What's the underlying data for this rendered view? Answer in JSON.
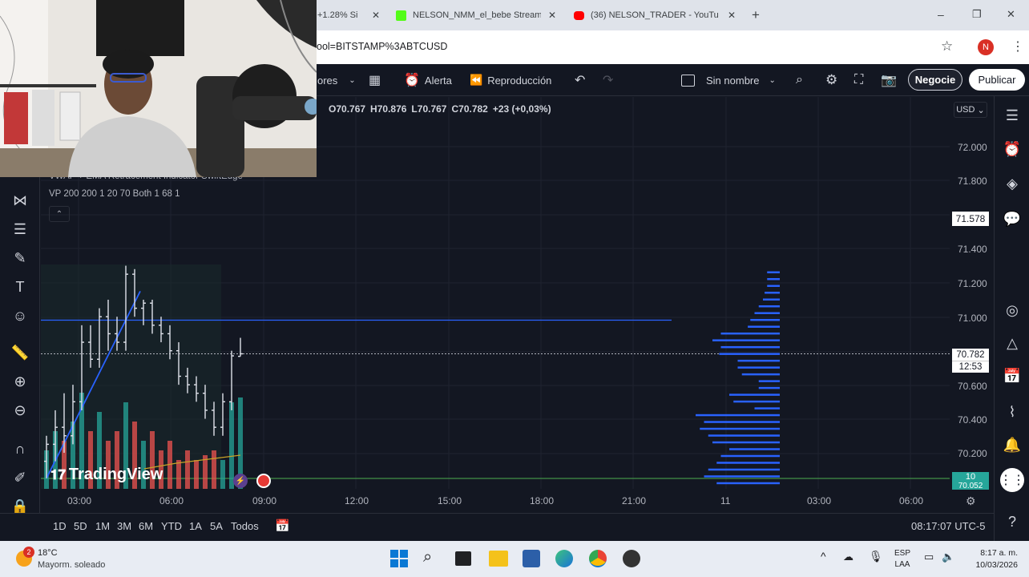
{
  "browser": {
    "tabs": [
      {
        "label": "+1.28% Si",
        "icon_color": "#f0b90b"
      },
      {
        "label": "NELSON_NMM_el_bebe Stream",
        "icon_color": "#53fc18"
      },
      {
        "label": "(36) NELSON_TRADER - YouTub",
        "icon_color": "#ff0000"
      }
    ],
    "new_tab": "+",
    "window_controls": [
      "–",
      "❐",
      "✕"
    ],
    "url": "ool=BITSTAMP%3ABTCUSD",
    "profile_initial": "N"
  },
  "toolbar": {
    "indicators_label": "ores",
    "alert_label": "Alerta",
    "replay_label": "Reproducción",
    "layout_name": "Sin nombre",
    "trade_button": "Negocie",
    "publish_button": "Publicar"
  },
  "legend": {
    "ohlc": [
      {
        "k": "O",
        "v": "70.767"
      },
      {
        "k": "H",
        "v": "70.876"
      },
      {
        "k": "L",
        "v": "70.767"
      },
      {
        "k": "C",
        "v": "70.782"
      }
    ],
    "change": "+23 (+0,03%)",
    "indicator_line1": "VWAP + EMA Retracement Indicator SwiftEdge",
    "indicator_line2": "VP 200 200 1 20 70 Both 1 68 1"
  },
  "price_axis": {
    "currency": "USD",
    "labels": [
      "72.000",
      "71.800",
      "71.400",
      "71.200",
      "71.000",
      "70.600",
      "70.400",
      "70.200"
    ],
    "highlight_label": "71.578",
    "current_price": "70.782",
    "countdown": "12:53",
    "volume_label": "10",
    "volume_sub": "70.052"
  },
  "time_axis": {
    "labels": [
      "03:00",
      "06:00",
      "09:00",
      "12:00",
      "15:00",
      "18:00",
      "21:00",
      "11",
      "03:00",
      "06:00"
    ]
  },
  "watermark": "TradingView",
  "range_buttons": [
    "1D",
    "5D",
    "1M",
    "3M",
    "6M",
    "YTD",
    "1A",
    "5A",
    "Todos"
  ],
  "clock": "08:17:07 UTC-5",
  "taskbar": {
    "weather_temp": "18°C",
    "weather_desc": "Mayorm. soleado",
    "weather_badge": "2",
    "lang": "ESP",
    "lang_sub": "LAA",
    "time": "8:17 a. m.",
    "date": "10/03/2026"
  },
  "colors": {
    "bg": "#131722",
    "up_candle": "#26a69a",
    "down_candle": "#ef5350",
    "vp_bar": "#2962ff",
    "trend_line": "#2962ff",
    "green_line": "#4caf50"
  },
  "chart_data": {
    "type": "candlestick",
    "price_range": [
      70.0,
      72.1
    ],
    "horizontal_line_price": 70.98,
    "current_price": 70.782,
    "volume_profile_bins": [
      {
        "price": 71.26,
        "vol": 0.15
      },
      {
        "price": 71.22,
        "vol": 0.15
      },
      {
        "price": 71.18,
        "vol": 0.15
      },
      {
        "price": 71.14,
        "vol": 0.18
      },
      {
        "price": 71.1,
        "vol": 0.2
      },
      {
        "price": 71.06,
        "vol": 0.25
      },
      {
        "price": 71.02,
        "vol": 0.3
      },
      {
        "price": 70.98,
        "vol": 0.35
      },
      {
        "price": 70.94,
        "vol": 0.38
      },
      {
        "price": 70.9,
        "vol": 0.7
      },
      {
        "price": 70.86,
        "vol": 0.8
      },
      {
        "price": 70.82,
        "vol": 0.7
      },
      {
        "price": 70.78,
        "vol": 0.72
      },
      {
        "price": 70.74,
        "vol": 0.5
      },
      {
        "price": 70.7,
        "vol": 0.5
      },
      {
        "price": 70.66,
        "vol": 0.45
      },
      {
        "price": 70.62,
        "vol": 0.25
      },
      {
        "price": 70.58,
        "vol": 0.25
      },
      {
        "price": 70.54,
        "vol": 0.6
      },
      {
        "price": 70.5,
        "vol": 0.55
      },
      {
        "price": 70.46,
        "vol": 0.3
      },
      {
        "price": 70.42,
        "vol": 1.0
      },
      {
        "price": 70.38,
        "vol": 0.9
      },
      {
        "price": 70.34,
        "vol": 0.95
      },
      {
        "price": 70.3,
        "vol": 0.85
      },
      {
        "price": 70.26,
        "vol": 0.8
      },
      {
        "price": 70.22,
        "vol": 0.6
      },
      {
        "price": 70.18,
        "vol": 0.7
      },
      {
        "price": 70.14,
        "vol": 0.75
      },
      {
        "price": 70.1,
        "vol": 0.85
      },
      {
        "price": 70.06,
        "vol": 0.9
      },
      {
        "price": 70.02,
        "vol": 0.75
      }
    ],
    "candles": [
      {
        "o": 70.15,
        "h": 70.3,
        "l": 70.05,
        "c": 70.25
      },
      {
        "o": 70.25,
        "h": 70.45,
        "l": 70.15,
        "c": 70.35
      },
      {
        "o": 70.35,
        "h": 70.55,
        "l": 70.2,
        "c": 70.3
      },
      {
        "o": 70.3,
        "h": 70.6,
        "l": 70.25,
        "c": 70.5
      },
      {
        "o": 70.5,
        "h": 70.95,
        "l": 70.45,
        "c": 70.85
      },
      {
        "o": 70.85,
        "h": 70.95,
        "l": 70.7,
        "c": 70.75
      },
      {
        "o": 70.75,
        "h": 71.05,
        "l": 70.7,
        "c": 71.0
      },
      {
        "o": 71.0,
        "h": 71.1,
        "l": 70.8,
        "c": 70.9
      },
      {
        "o": 70.9,
        "h": 71.0,
        "l": 70.8,
        "c": 70.85
      },
      {
        "o": 70.85,
        "h": 71.3,
        "l": 70.8,
        "c": 71.25
      },
      {
        "o": 71.25,
        "h": 71.28,
        "l": 71.0,
        "c": 71.05
      },
      {
        "o": 71.05,
        "h": 71.1,
        "l": 70.95,
        "c": 71.08
      },
      {
        "o": 71.08,
        "h": 71.1,
        "l": 70.9,
        "c": 70.95
      },
      {
        "o": 70.95,
        "h": 71.0,
        "l": 70.85,
        "c": 70.9
      },
      {
        "o": 70.9,
        "h": 70.95,
        "l": 70.75,
        "c": 70.8
      },
      {
        "o": 70.8,
        "h": 70.85,
        "l": 70.6,
        "c": 70.65
      },
      {
        "o": 70.65,
        "h": 70.7,
        "l": 70.55,
        "c": 70.6
      },
      {
        "o": 70.6,
        "h": 70.65,
        "l": 70.5,
        "c": 70.55
      },
      {
        "o": 70.55,
        "h": 70.6,
        "l": 70.4,
        "c": 70.45
      },
      {
        "o": 70.45,
        "h": 70.5,
        "l": 70.3,
        "c": 70.35
      },
      {
        "o": 70.35,
        "h": 70.55,
        "l": 70.3,
        "c": 70.5
      },
      {
        "o": 70.5,
        "h": 70.8,
        "l": 70.45,
        "c": 70.77
      },
      {
        "o": 70.767,
        "h": 70.876,
        "l": 70.767,
        "c": 70.782
      }
    ],
    "volumes": [
      0.4,
      0.6,
      0.5,
      0.7,
      1.0,
      0.6,
      0.8,
      0.5,
      0.6,
      0.9,
      0.7,
      0.5,
      0.6,
      0.4,
      0.5,
      0.3,
      0.4,
      0.3,
      0.35,
      0.4,
      0.3,
      0.9,
      0.95
    ]
  }
}
